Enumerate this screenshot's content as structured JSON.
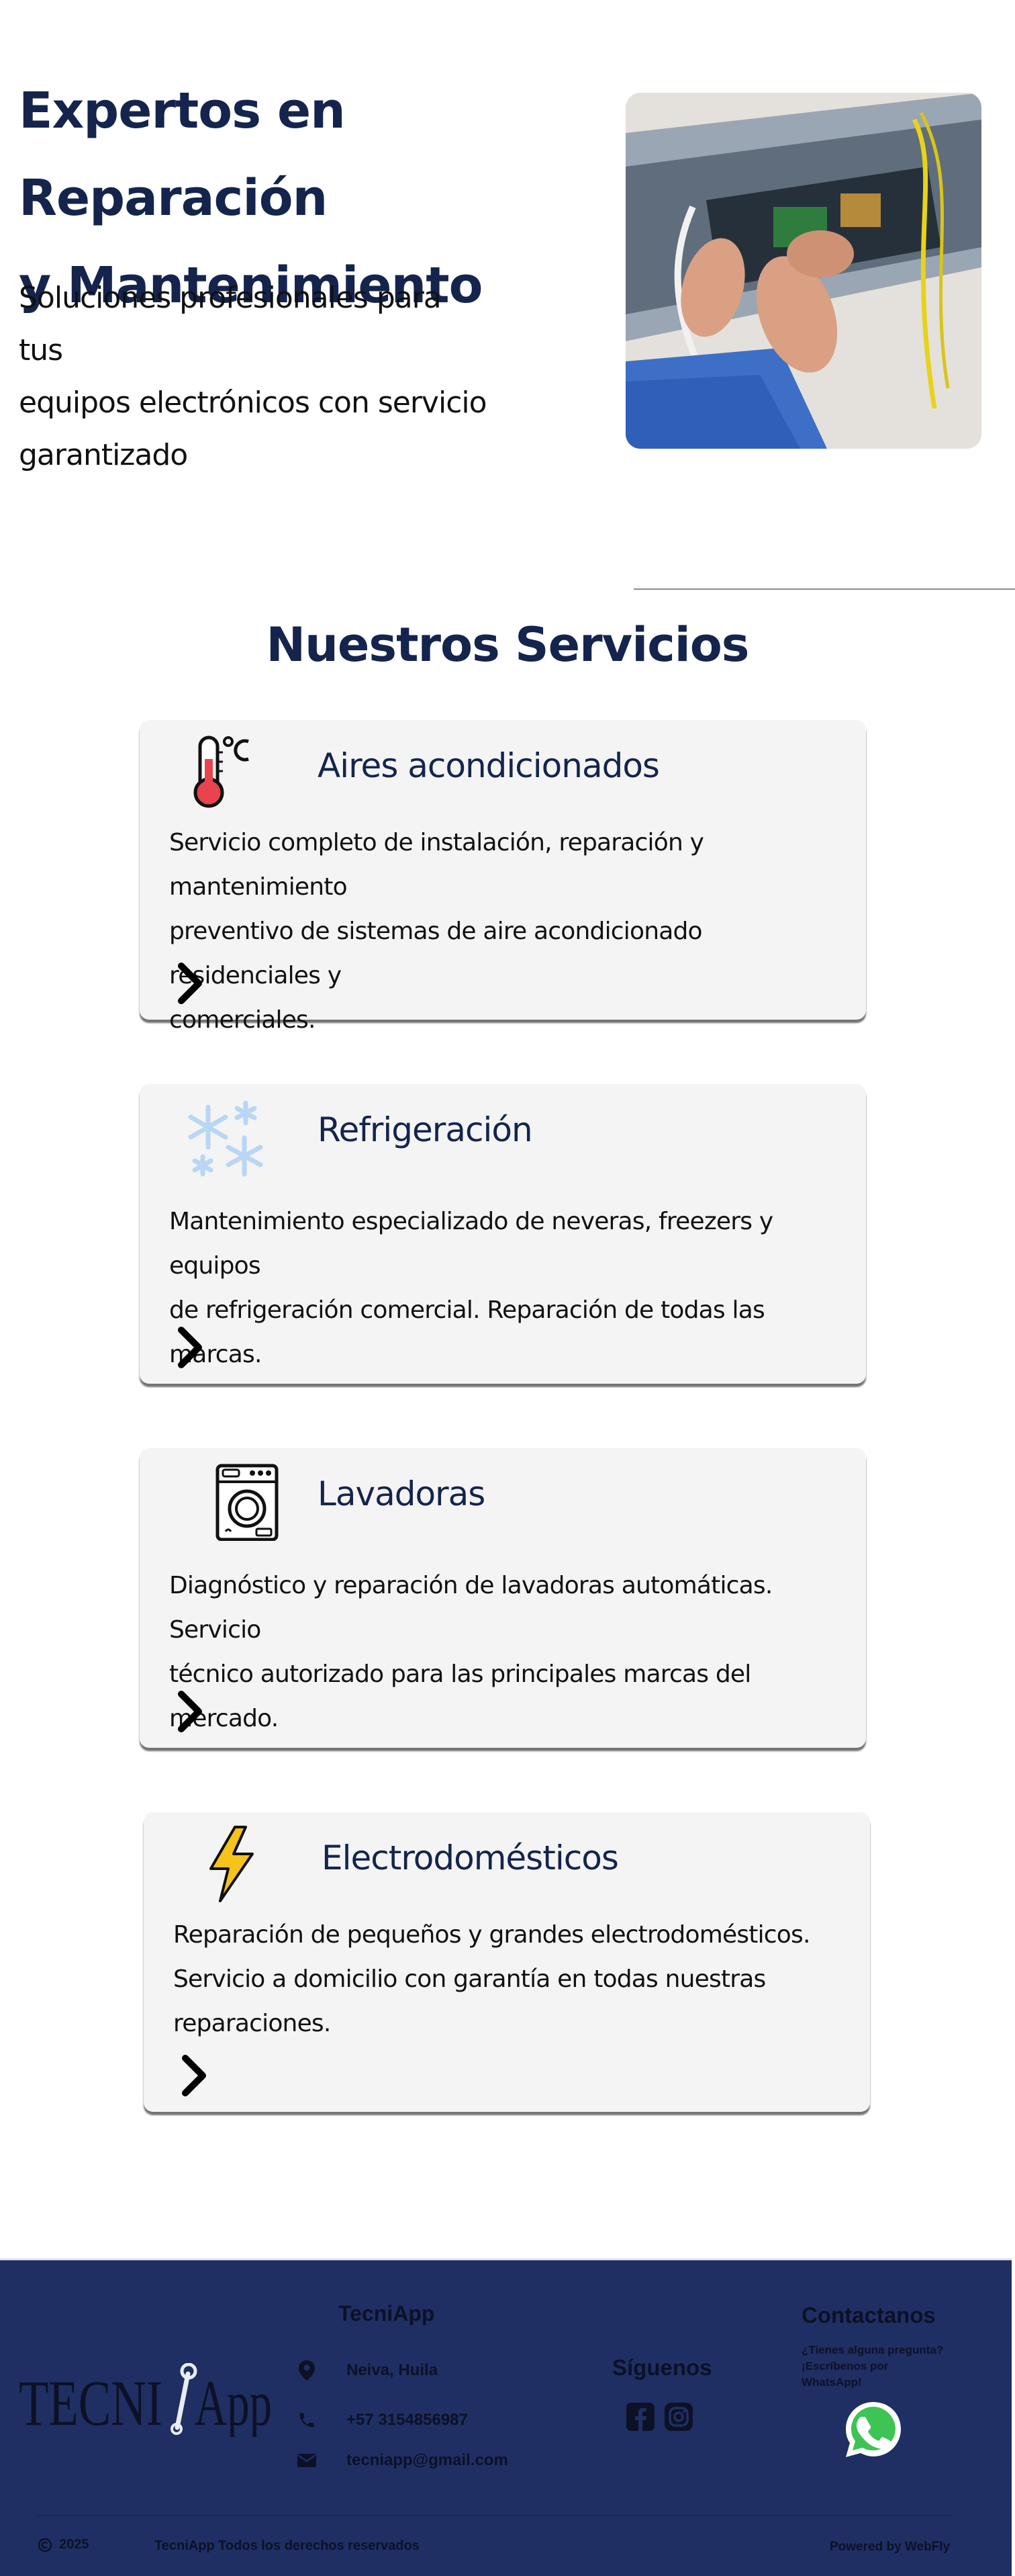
{
  "hero": {
    "title_line1": "Expertos en Reparación",
    "title_line2": "y Mantenimiento",
    "subtitle_line1": "Soluciones profesionales para tus",
    "subtitle_line2": "equipos electrónicos con servicio",
    "subtitle_line3": "garantizado"
  },
  "services": {
    "title": "Nuestros Servicios",
    "items": [
      {
        "title": "Aires acondicionados",
        "icon": "thermometer-icon",
        "desc_lines": [
          "Servicio completo de instalación, reparación y mantenimiento",
          "preventivo de sistemas de aire acondicionado residenciales y",
          "comerciales."
        ]
      },
      {
        "title": "Refrigeración",
        "icon": "snowflake-icon",
        "desc_lines": [
          "Mantenimiento especializado de neveras, freezers y equipos",
          "de refrigeración comercial. Reparación de todas las marcas."
        ]
      },
      {
        "title": "Lavadoras",
        "icon": "washing-machine-icon",
        "desc_lines": [
          "Diagnóstico y reparación de lavadoras automáticas. Servicio",
          "técnico autorizado para las principales marcas del mercado."
        ]
      },
      {
        "title": "Electrodomésticos",
        "icon": "lightning-icon",
        "desc_lines": [
          "Reparación de pequeños y grandes electrodomésticos.",
          "Servicio a domicilio con garantía en todas nuestras",
          "reparaciones."
        ]
      }
    ]
  },
  "footer": {
    "logo_left": "TECNI",
    "logo_right": "App",
    "brand": "TecniApp",
    "location": "Neiva, Huila",
    "phone": "+57 3154856987",
    "email": "tecniapp@gmail.com",
    "follow_title": "Síguenos",
    "contact_title": "Contactanos",
    "contact_line1": "¿Tienes alguna pregunta?",
    "contact_line2": "¡Escríbenos por",
    "contact_line3": "WhatsApp!",
    "copyright_year": "2025",
    "rights": "TecniApp  Todos los derechos reservados",
    "powered": "Powered by WebFly"
  },
  "colors": {
    "primary": "#14244d",
    "footer_bg": "#1f2f63",
    "card_bg": "#f4f4f4"
  }
}
